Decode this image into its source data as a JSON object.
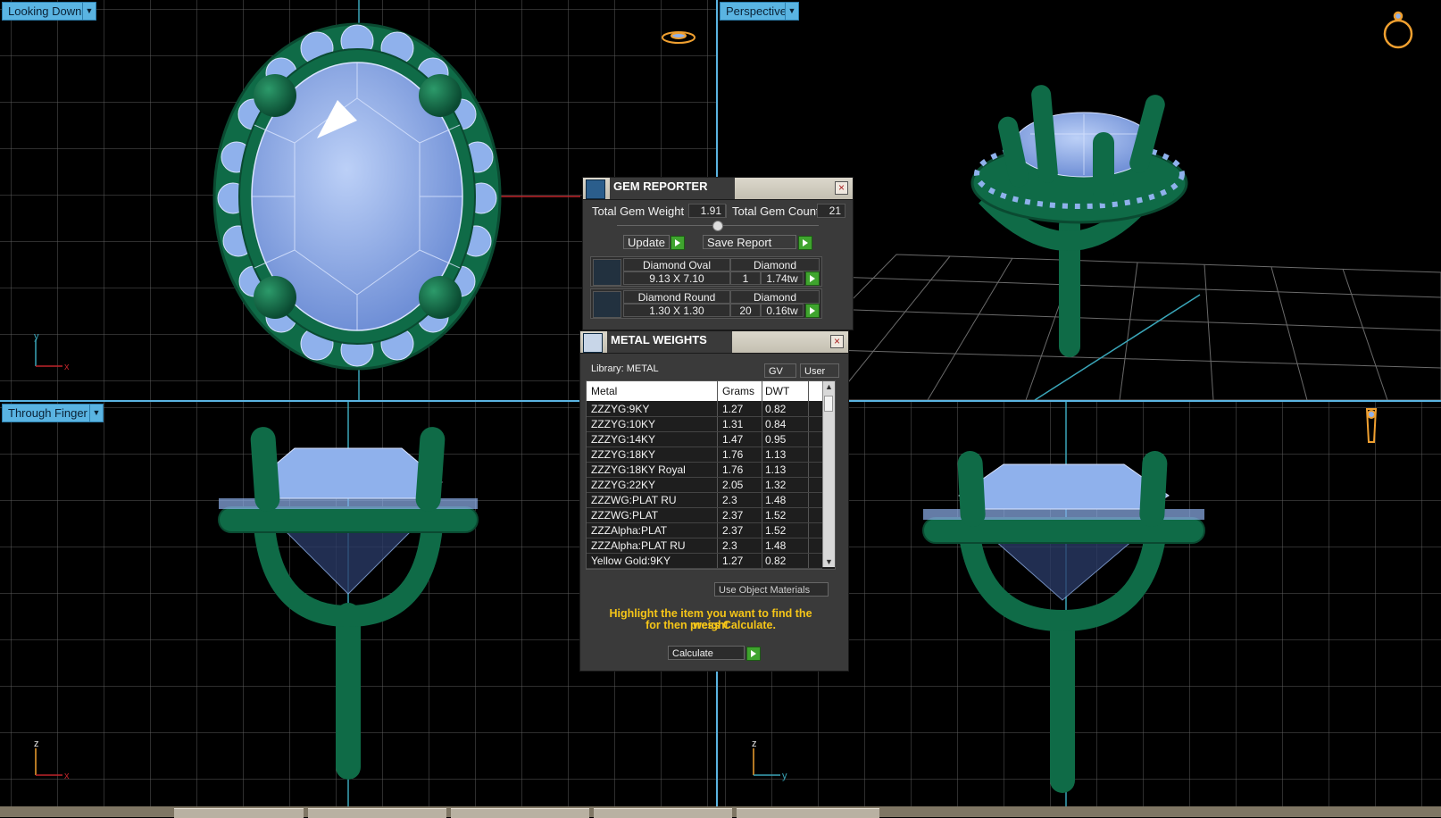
{
  "viewports": {
    "top_left": {
      "label": "Looking Down",
      "axis_h": "x",
      "axis_v": "y"
    },
    "top_right": {
      "label": "Perspective"
    },
    "bottom_left": {
      "label": "Through Finger",
      "axis_h": "x",
      "axis_v": "z"
    },
    "bottom_right": {
      "label": "",
      "axis_h": "y",
      "axis_v": "z"
    }
  },
  "gem_reporter": {
    "title": "GEM REPORTER",
    "total_weight_label": "Total Gem Weight",
    "total_weight": "1.91",
    "total_count_label": "Total Gem Count",
    "total_count": "21",
    "update_label": "Update",
    "save_report_label": "Save Report",
    "gems": [
      {
        "name": "Diamond Oval",
        "material": "Diamond",
        "size": "9.13 X 7.10",
        "count": "1",
        "weight": "1.74tw"
      },
      {
        "name": "Diamond Round",
        "material": "Diamond",
        "size": "1.30 X 1.30",
        "count": "20",
        "weight": "0.16tw"
      }
    ]
  },
  "metal_weights": {
    "title": "METAL WEIGHTS",
    "library_label": "Library: METAL",
    "gv_label": "GV",
    "user_label": "User",
    "columns": [
      "Metal",
      "Grams",
      "DWT"
    ],
    "rows": [
      [
        "ZZZYG:9KY",
        "1.27",
        "0.82"
      ],
      [
        "ZZZYG:10KY",
        "1.31",
        "0.84"
      ],
      [
        "ZZZYG:14KY",
        "1.47",
        "0.95"
      ],
      [
        "ZZZYG:18KY",
        "1.76",
        "1.13"
      ],
      [
        "ZZZYG:18KY Royal",
        "1.76",
        "1.13"
      ],
      [
        "ZZZYG:22KY",
        "2.05",
        "1.32"
      ],
      [
        "ZZZWG:PLAT RU",
        "2.3",
        "1.48"
      ],
      [
        "ZZZWG:PLAT",
        "2.37",
        "1.52"
      ],
      [
        "ZZZAlpha:PLAT",
        "2.37",
        "1.52"
      ],
      [
        "ZZZAlpha:PLAT RU",
        "2.3",
        "1.48"
      ],
      [
        "Yellow Gold:9KY",
        "1.27",
        "0.82"
      ]
    ],
    "use_object_materials_label": "Use Object Materials",
    "hint_line1": "Highlight the item you want to find the weight",
    "hint_line2": "for then press Calculate.",
    "calculate_label": "Calculate"
  },
  "colors": {
    "metal": "#0f6b47",
    "gem": "#8fb1ec",
    "grid": "#5d5d5d",
    "axis": "#3aa6b9",
    "viewport_label": "#5ab4e2",
    "hint": "#f5c518"
  }
}
